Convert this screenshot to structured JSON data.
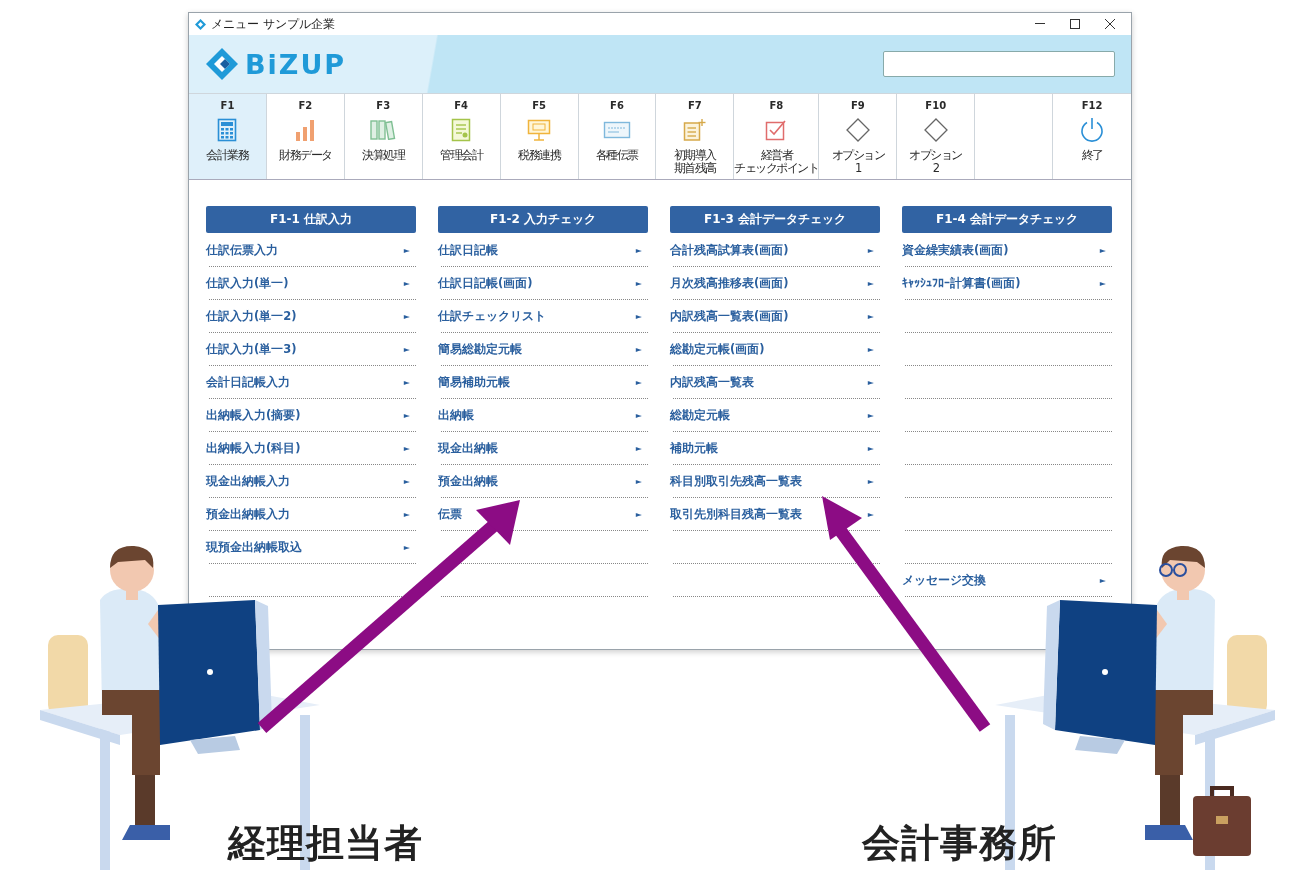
{
  "window": {
    "title": "メニュー サンプル企業",
    "logo": "BiZUP"
  },
  "function_keys": [
    {
      "kind": "key",
      "key": "F1",
      "lines": [
        "会計業務"
      ],
      "selected": true
    },
    {
      "kind": "key",
      "key": "F2",
      "lines": [
        "財務データ"
      ],
      "selected": false
    },
    {
      "kind": "key",
      "key": "F3",
      "lines": [
        "決算処理"
      ],
      "selected": false
    },
    {
      "kind": "key",
      "key": "F4",
      "lines": [
        "管理会計"
      ],
      "selected": false
    },
    {
      "kind": "key",
      "key": "F5",
      "lines": [
        "税務連携"
      ],
      "selected": false
    },
    {
      "kind": "key",
      "key": "F6",
      "lines": [
        "各種伝票"
      ],
      "selected": false
    },
    {
      "kind": "key",
      "key": "F7",
      "lines": [
        "初期導入",
        "期首残高"
      ],
      "selected": false
    },
    {
      "kind": "key",
      "key": "F8",
      "lines": [
        "経営者",
        "チェックポイント"
      ],
      "selected": false
    },
    {
      "kind": "key",
      "key": "F9",
      "lines": [
        "オプション",
        "1"
      ],
      "selected": false
    },
    {
      "kind": "key",
      "key": "F10",
      "lines": [
        "オプション",
        "2"
      ],
      "selected": false
    },
    {
      "kind": "empty"
    },
    {
      "kind": "key",
      "key": "F12",
      "lines": [
        "終了"
      ],
      "selected": false
    }
  ],
  "menu_columns": [
    {
      "title": "F1-1 仕訳入力",
      "rows": [
        {
          "kind": "item",
          "label": "仕訳伝票入力",
          "arrow": "►"
        },
        {
          "kind": "item",
          "label": "仕訳入力(単一)",
          "arrow": "►"
        },
        {
          "kind": "item",
          "label": "仕訳入力(単一2)",
          "arrow": "►"
        },
        {
          "kind": "item",
          "label": "仕訳入力(単一3)",
          "arrow": "►"
        },
        {
          "kind": "item",
          "label": "会計日記帳入力",
          "arrow": "►"
        },
        {
          "kind": "item",
          "label": "出納帳入力(摘要)",
          "arrow": "►"
        },
        {
          "kind": "item",
          "label": "出納帳入力(科目)",
          "arrow": "►"
        },
        {
          "kind": "item",
          "label": "現金出納帳入力",
          "arrow": "►"
        },
        {
          "kind": "item",
          "label": "預金出納帳入力",
          "arrow": "►"
        },
        {
          "kind": "item",
          "label": "現預金出納帳取込",
          "arrow": "►"
        },
        {
          "kind": "blank"
        }
      ]
    },
    {
      "title": "F1-2 入力チェック",
      "rows": [
        {
          "kind": "item",
          "label": "仕訳日記帳",
          "arrow": "►"
        },
        {
          "kind": "item",
          "label": "仕訳日記帳(画面)",
          "arrow": "►"
        },
        {
          "kind": "item",
          "label": "仕訳チェックリスト",
          "arrow": "►"
        },
        {
          "kind": "item",
          "label": "簡易総勘定元帳",
          "arrow": "►"
        },
        {
          "kind": "item",
          "label": "簡易補助元帳",
          "arrow": "►"
        },
        {
          "kind": "item",
          "label": "出納帳",
          "arrow": "►"
        },
        {
          "kind": "item",
          "label": "現金出納帳",
          "arrow": "►"
        },
        {
          "kind": "item",
          "label": "預金出納帳",
          "arrow": "►"
        },
        {
          "kind": "item",
          "label": "伝票",
          "arrow": "►"
        },
        {
          "kind": "blank"
        },
        {
          "kind": "blank"
        }
      ]
    },
    {
      "title": "F1-3 会計データチェック",
      "rows": [
        {
          "kind": "item",
          "label": "合計残高試算表(画面)",
          "arrow": "►"
        },
        {
          "kind": "item",
          "label": "月次残高推移表(画面)",
          "arrow": "►"
        },
        {
          "kind": "item",
          "label": "内訳残高一覧表(画面)",
          "arrow": "►"
        },
        {
          "kind": "item",
          "label": "総勘定元帳(画面)",
          "arrow": "►"
        },
        {
          "kind": "item",
          "label": "内訳残高一覧表",
          "arrow": "►"
        },
        {
          "kind": "item",
          "label": "総勘定元帳",
          "arrow": "►"
        },
        {
          "kind": "item",
          "label": "補助元帳",
          "arrow": "►"
        },
        {
          "kind": "item",
          "label": "科目別取引先残高一覧表",
          "arrow": "►"
        },
        {
          "kind": "item",
          "label": "取引先別科目残高一覧表",
          "arrow": "►"
        },
        {
          "kind": "blank"
        },
        {
          "kind": "blank"
        }
      ]
    },
    {
      "title": "F1-4 会計データチェック",
      "rows": [
        {
          "kind": "item",
          "label": "資金繰実績表(画面)",
          "arrow": "►"
        },
        {
          "kind": "item",
          "label": "ｷｬｯｼｭﾌﾛｰ計算書(画面)",
          "arrow": "►"
        },
        {
          "kind": "blank"
        },
        {
          "kind": "blank"
        },
        {
          "kind": "blank"
        },
        {
          "kind": "blank"
        },
        {
          "kind": "blank"
        },
        {
          "kind": "blank"
        },
        {
          "kind": "blank"
        },
        {
          "kind": "blank"
        },
        {
          "kind": "item",
          "label": "メッセージ交換",
          "arrow": "►"
        }
      ]
    }
  ],
  "captions": [
    {
      "label": "経理担当者"
    },
    {
      "label": "会計事務所"
    }
  ]
}
